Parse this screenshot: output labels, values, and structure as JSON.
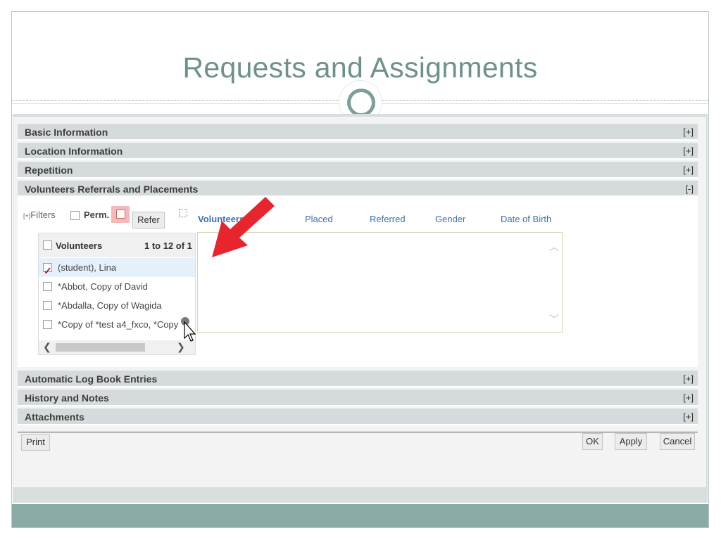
{
  "slide": {
    "title": "Requests and Assignments"
  },
  "sections": {
    "basic": {
      "label": "Basic Information",
      "toggle": "[+]"
    },
    "location": {
      "label": "Location Information",
      "toggle": "[+]"
    },
    "repetition": {
      "label": "Repetition",
      "toggle": "[+]"
    },
    "volunteers": {
      "label": "Volunteers Referrals and Placements",
      "toggle": "[-]"
    },
    "logbook": {
      "label": "Automatic Log Book Entries",
      "toggle": "[+]"
    },
    "history": {
      "label": "History and Notes",
      "toggle": "[+]"
    },
    "attachments": {
      "label": "Attachments",
      "toggle": "[+]"
    }
  },
  "filters": {
    "prefix": "[+]",
    "label": "Filters",
    "perm_label": "Perm.",
    "refer_button": "Refer"
  },
  "volunteer_list": {
    "header_label": "Volunteers",
    "range_label": "1 to 12 of 1",
    "rows": [
      {
        "name": "(student), Lina",
        "checked": true
      },
      {
        "name": "*Abbot, Copy of David",
        "checked": false
      },
      {
        "name": "*Abdalla, Copy of Wagida",
        "checked": false
      },
      {
        "name": "*Copy of *test a4_fxco, *Copy",
        "checked": false
      }
    ]
  },
  "grid": {
    "columns": [
      "Volunteers",
      "Placed",
      "Referred",
      "Gender",
      "Date of Birth"
    ]
  },
  "buttons": {
    "print": "Print",
    "ok": "OK",
    "apply": "Apply",
    "cancel": "Cancel"
  },
  "colors": {
    "title": "#6d918c",
    "accent_red": "#e8252c",
    "link_blue": "#3e6fb2",
    "section_bar": "#d5dbdc",
    "footer_band": "#8aaaa5"
  }
}
